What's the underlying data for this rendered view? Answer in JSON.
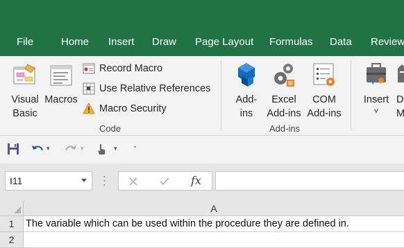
{
  "tabs": [
    "File",
    "Home",
    "Insert",
    "Draw",
    "Page Layout",
    "Formulas",
    "Data",
    "Review"
  ],
  "ribbon": {
    "code_group": {
      "label": "Code",
      "visual_basic": [
        "Visual",
        "Basic"
      ],
      "macros": "Macros",
      "record_macro": "Record Macro",
      "use_relative_references": "Use Relative References",
      "macro_security": "Macro Security"
    },
    "addins_group": {
      "label": "Add-ins",
      "addins": [
        "Add-",
        "ins"
      ],
      "excel_addins": [
        "Excel",
        "Add-ins"
      ],
      "com_addins": [
        "COM",
        "Add-ins"
      ]
    },
    "controls_group": {
      "insert": "Insert",
      "insert_dropdown": "˅",
      "design_mode_partial": [
        "D",
        "M"
      ]
    }
  },
  "formula_bar": {
    "name_box": "I11",
    "formula_value": ""
  },
  "sheet": {
    "column_headers": [
      "A"
    ],
    "rows": [
      {
        "row": "1",
        "A": "The variable which can be used within the procedure they are defined in."
      },
      {
        "row": "2",
        "A": ""
      }
    ]
  },
  "colors": {
    "brand_green": "#217346",
    "ribbon_bg": "#f3f3f3",
    "header_bg": "#e6e6e6"
  },
  "icons": [
    "visual-basic-icon",
    "macros-icon",
    "record-macro-icon",
    "relative-references-icon",
    "warning-icon",
    "addins-icon",
    "excel-addins-gear-icon",
    "com-addins-icon",
    "insert-controls-icon",
    "save-icon",
    "undo-icon",
    "redo-icon",
    "touch-mode-icon",
    "customize-qat-icon",
    "cancel-x-icon",
    "enter-check-icon",
    "function-fx-icon"
  ]
}
